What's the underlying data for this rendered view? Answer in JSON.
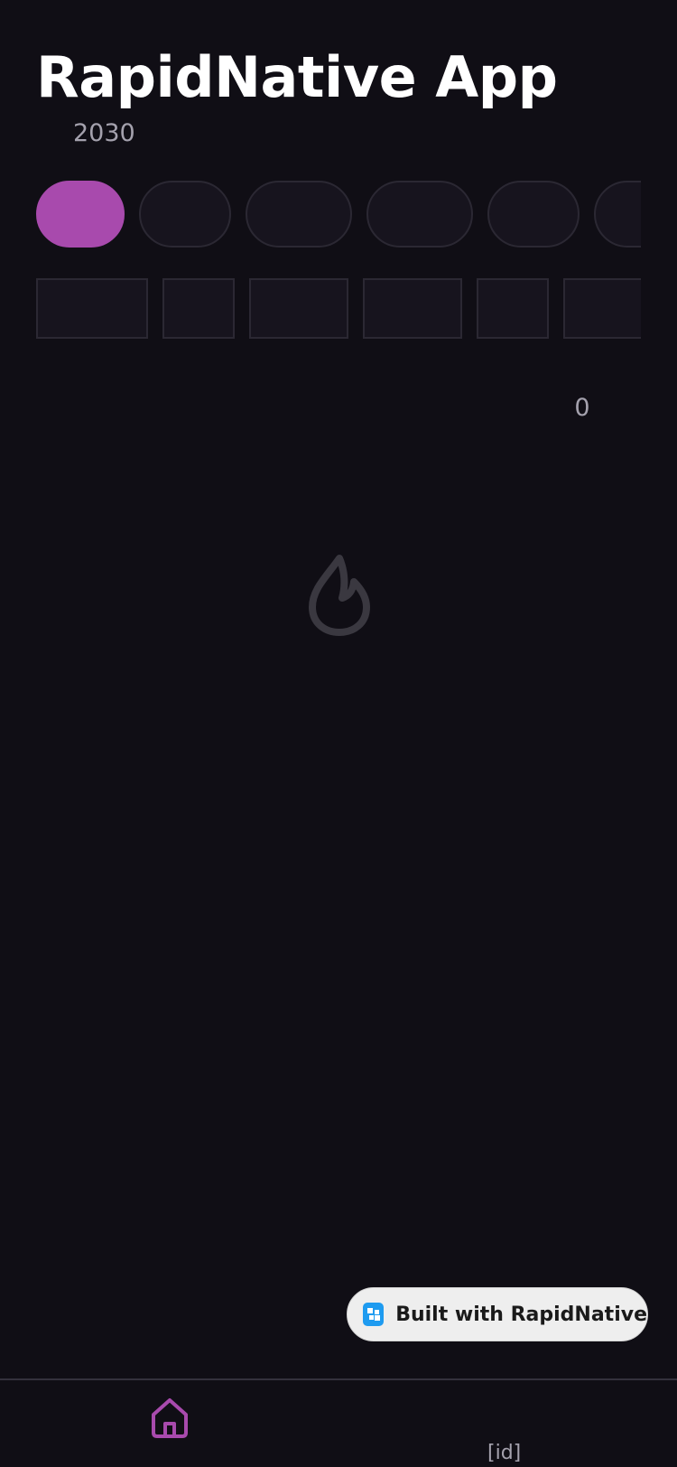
{
  "app": {
    "title": "RapidNative App",
    "year": "2030"
  },
  "filters": {
    "chips": [
      {
        "label": "",
        "active": true
      },
      {
        "label": "",
        "active": false
      },
      {
        "label": "",
        "active": false
      },
      {
        "label": "",
        "active": false
      },
      {
        "label": "",
        "active": false
      },
      {
        "label": "",
        "active": false
      }
    ],
    "boxes": [
      "",
      "",
      "",
      "",
      "",
      ""
    ]
  },
  "list": {
    "count": "0",
    "empty_icon": "flame-icon"
  },
  "badge": {
    "label": "Built with RapidNative",
    "icon": "rapidnative-logo-icon"
  },
  "tabbar": {
    "tabs": [
      {
        "icon": "home-icon",
        "label": "",
        "active": true
      },
      {
        "icon": "",
        "label": "[id]",
        "active": false
      }
    ]
  },
  "colors": {
    "background": "#100e15",
    "accent": "#a84aad",
    "muted_text": "#a4a1ad",
    "border": "#2b2833",
    "badge_bg": "#eeeeee",
    "badge_icon": "#1e9bf0"
  }
}
